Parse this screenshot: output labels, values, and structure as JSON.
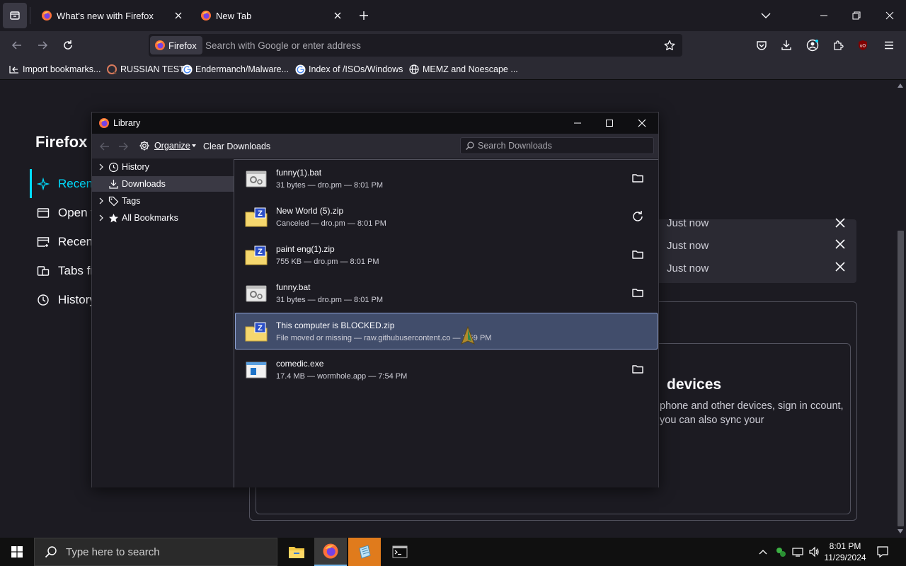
{
  "browser": {
    "tabs": [
      {
        "title": "What's new with Firefox",
        "active": false
      },
      {
        "title": "New Tab",
        "active": true
      }
    ],
    "identity_label": "Firefox",
    "url_placeholder": "Search with Google or enter address",
    "bookmarks": [
      {
        "label": "Import bookmarks...",
        "icon": "import-icon"
      },
      {
        "label": "RUSSIAN TEST",
        "icon": "site-icon"
      },
      {
        "label": "Endermanch/Malware...",
        "icon": "google-icon"
      },
      {
        "label": "Index of /ISOs/Windows",
        "icon": "google-icon"
      },
      {
        "label": "MEMZ and Noescape ...",
        "icon": "globe-icon"
      }
    ],
    "ublock_badge": "uO"
  },
  "page": {
    "title": "Firefox V",
    "side_nav": [
      {
        "label": "Recent",
        "icon": "sparkle-icon",
        "active": true
      },
      {
        "label": "Open t",
        "icon": "window-icon"
      },
      {
        "label": "Recent",
        "icon": "recent-window-icon"
      },
      {
        "label": "Tabs fr",
        "icon": "tabs-icon"
      },
      {
        "label": "History",
        "icon": "clock-icon"
      }
    ],
    "recent_times": [
      "Just now",
      "Just now",
      "Just now"
    ],
    "devices_title": "devices",
    "devices_text": "phone and other devices, sign in ccount, you can also sync your"
  },
  "library": {
    "title": "Library",
    "organize_label": "Organize",
    "clear_label": "Clear Downloads",
    "search_placeholder": "Search Downloads",
    "tree": [
      {
        "label": "History",
        "icon": "clock-icon",
        "expandable": true
      },
      {
        "label": "Downloads",
        "icon": "download-icon",
        "expandable": false,
        "selected": true
      },
      {
        "label": "Tags",
        "icon": "tag-icon",
        "expandable": true
      },
      {
        "label": "All Bookmarks",
        "icon": "star-icon",
        "expandable": true
      }
    ],
    "downloads": [
      {
        "name": "funny(1).bat",
        "meta": "31 bytes — dro.pm — 8:01 PM",
        "type": "bat",
        "action": "folder-icon"
      },
      {
        "name": "New World (5).zip",
        "meta": "Canceled — dro.pm — 8:01 PM",
        "type": "zip",
        "action": "retry-icon"
      },
      {
        "name": "paint eng(1).zip",
        "meta": "755 KB — dro.pm — 8:01 PM",
        "type": "zip",
        "action": "folder-icon"
      },
      {
        "name": "funny.bat",
        "meta": "31 bytes — dro.pm — 8:01 PM",
        "type": "bat",
        "action": "folder-icon"
      },
      {
        "name": "This computer is BLOCKED.zip",
        "meta": "File moved or missing — raw.githubusercontent.co — 7:59 PM",
        "type": "zip",
        "action": "none",
        "selected": true
      },
      {
        "name": "comedic.exe",
        "meta": "17.4 MB — wormhole.app — 7:54 PM",
        "type": "exe",
        "action": "folder-icon"
      }
    ]
  },
  "taskbar": {
    "search_placeholder": "Type here to search",
    "time": "8:01 PM",
    "date": "11/29/2024"
  },
  "colors": {
    "accent": "#00ddff",
    "selection": "#414d6b",
    "chrome": "#2b2a33",
    "background": "#1c1b22"
  }
}
